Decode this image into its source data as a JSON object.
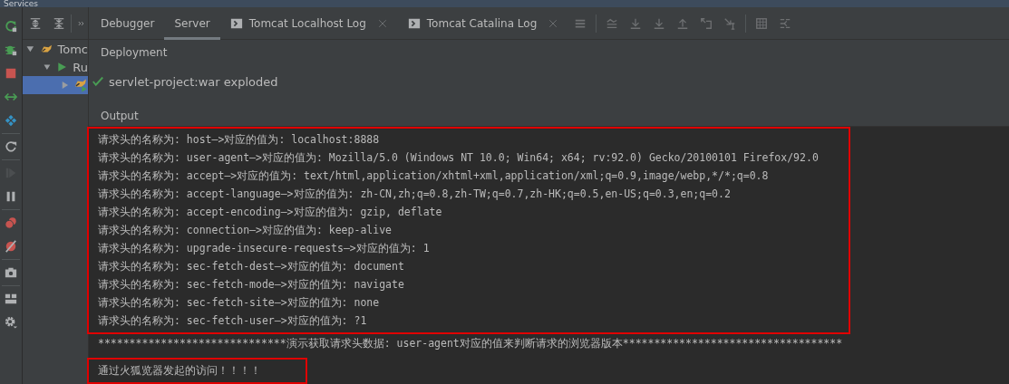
{
  "window": {
    "title": "Services"
  },
  "tree_toolbar": [
    {
      "kind": "expand"
    },
    {
      "kind": "collapse"
    },
    {
      "kind": "more"
    }
  ],
  "side_toolbar": [
    {
      "kind": "rerun",
      "disabled": false
    },
    {
      "kind": "debug",
      "disabled": false
    },
    {
      "kind": "stop",
      "disabled": false
    },
    {
      "kind": "deploy",
      "disabled": false
    },
    {
      "kind": "structure",
      "disabled": false
    },
    {
      "kind": "refresh",
      "disabled": false
    },
    {
      "kind": "resume",
      "disabled": true
    },
    {
      "kind": "pause",
      "disabled": false
    },
    {
      "kind": "breakpoints",
      "disabled": false
    },
    {
      "kind": "mute",
      "disabled": false
    },
    {
      "kind": "camera",
      "disabled": false
    },
    {
      "kind": "layout",
      "disabled": false
    },
    {
      "kind": "settings",
      "disabled": false
    }
  ],
  "tree": [
    {
      "label": "Tomc",
      "kind": "tomcat",
      "expanded": true,
      "selected": false,
      "children": [
        {
          "label": "Ru",
          "kind": "run",
          "expanded": true,
          "selected": false,
          "children": [
            {
              "kind": "artifact",
              "expanded": false,
              "selected": true
            }
          ]
        }
      ]
    }
  ],
  "tabs": [
    {
      "label": "Debugger",
      "kind": "plain",
      "selected": false
    },
    {
      "label": "Server",
      "kind": "plain",
      "selected": true
    },
    {
      "label": "Tomcat Localhost Log",
      "kind": "log",
      "selected": false
    },
    {
      "label": "Tomcat Catalina Log",
      "kind": "log",
      "selected": false
    }
  ],
  "tab_toolbar": [
    {
      "kind": "menu"
    },
    {
      "kind": "scroll-end"
    },
    {
      "kind": "down"
    },
    {
      "kind": "down"
    },
    {
      "kind": "up"
    },
    {
      "kind": "restore"
    },
    {
      "kind": "cursor"
    },
    {
      "kind": "table"
    },
    {
      "kind": "split"
    }
  ],
  "deployment": {
    "title": "Deployment",
    "items": [
      {
        "label": "servlet-project:war exploded",
        "deployed": true
      }
    ]
  },
  "output": {
    "title": "Output",
    "blocks": [
      {
        "highlighted": true,
        "lines": [
          "请求头的名称为: host—>对应的值为: localhost:8888",
          "请求头的名称为: user-agent—>对应的值为: Mozilla/5.0 (Windows NT 10.0; Win64; x64; rv:92.0) Gecko/20100101 Firefox/92.0",
          "请求头的名称为: accept—>对应的值为: text/html,application/xhtml+xml,application/xml;q=0.9,image/webp,*/*;q=0.8",
          "请求头的名称为: accept-language—>对应的值为: zh-CN,zh;q=0.8,zh-TW;q=0.7,zh-HK;q=0.5,en-US;q=0.3,en;q=0.2",
          "请求头的名称为: accept-encoding—>对应的值为: gzip, deflate",
          "请求头的名称为: connection—>对应的值为: keep-alive",
          "请求头的名称为: upgrade-insecure-requests—>对应的值为: 1",
          "请求头的名称为: sec-fetch-dest—>对应的值为: document",
          "请求头的名称为: sec-fetch-mode—>对应的值为: navigate",
          "请求头的名称为: sec-fetch-site—>对应的值为: none",
          "请求头的名称为: sec-fetch-user—>对应的值为: ?1"
        ]
      },
      {
        "highlighted": false,
        "lines": [
          "******************************演示获取请求头数据: user-agent对应的值来判断请求的浏览器版本***********************************"
        ]
      },
      {
        "highlighted": true,
        "lines": [
          "通过火狐览器发起的访问！！！！"
        ]
      }
    ]
  }
}
